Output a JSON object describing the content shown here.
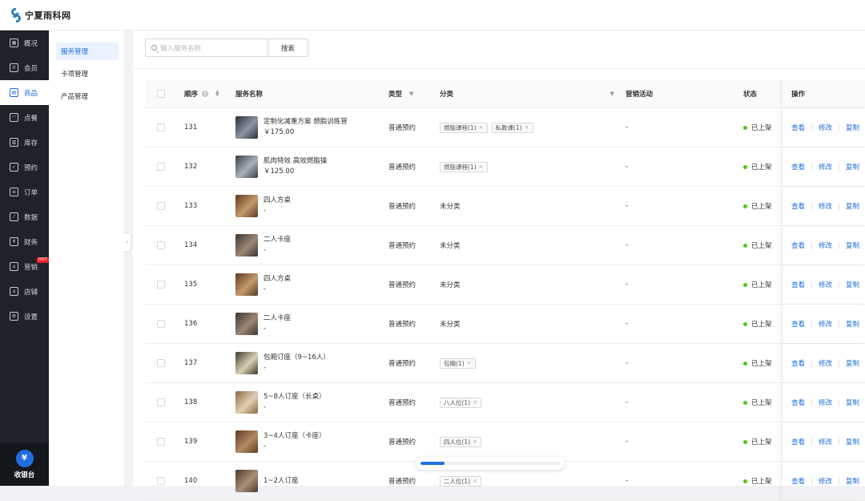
{
  "brand": {
    "name": "宁夏雨科网"
  },
  "main_nav": [
    {
      "label": "概况",
      "icon": "overview-icon",
      "glyph": "▦"
    },
    {
      "label": "会员",
      "icon": "crown-icon",
      "glyph": "♔"
    },
    {
      "label": "商品",
      "icon": "store-icon",
      "glyph": "▤",
      "active": true
    },
    {
      "label": "点餐",
      "icon": "dish-icon",
      "glyph": "◠"
    },
    {
      "label": "库存",
      "icon": "inventory-icon",
      "glyph": "▥"
    },
    {
      "label": "预约",
      "icon": "calendar-check-icon",
      "glyph": "✓"
    },
    {
      "label": "订单",
      "icon": "order-icon",
      "glyph": "≡"
    },
    {
      "label": "数据",
      "icon": "chart-icon",
      "glyph": "⟋"
    },
    {
      "label": "财务",
      "icon": "finance-icon",
      "glyph": "¥"
    },
    {
      "label": "营销",
      "icon": "marketing-icon",
      "glyph": "⌂",
      "badge": "HOT"
    },
    {
      "label": "店铺",
      "icon": "shop-icon",
      "glyph": "⌂"
    },
    {
      "label": "设置",
      "icon": "settings-icon",
      "glyph": "⚙"
    }
  ],
  "cashier": {
    "label": "收银台",
    "glyph": "¥"
  },
  "sub_nav": [
    {
      "label": "服务管理",
      "active": true
    },
    {
      "label": "卡项管理"
    },
    {
      "label": "产品管理"
    }
  ],
  "search": {
    "placeholder": "输入服务名称",
    "button": "搜索"
  },
  "table": {
    "headers": {
      "seq": "顺序",
      "name": "服务名称",
      "type": "类型",
      "category": "分类",
      "marketing": "营销活动",
      "status": "状态",
      "actions": "操作"
    },
    "rows": [
      {
        "seq": "131",
        "name": "定制化减重方案 燃脂训练营",
        "sub": "￥175.00",
        "type": "普通预约",
        "tags": [
          "燃脂课程(1)",
          "私教课(1)"
        ],
        "category_text": "",
        "marketing": "-",
        "status": "已上架",
        "thumb": [
          "#2b2f36",
          "#8b95a3"
        ]
      },
      {
        "seq": "132",
        "name": "肌肉特效 高效燃脂操",
        "sub": "￥125.00",
        "type": "普通预约",
        "tags": [
          "燃脂课程(1)"
        ],
        "category_text": "",
        "marketing": "-",
        "status": "已上架",
        "thumb": [
          "#3a3f47",
          "#a9b0ba"
        ]
      },
      {
        "seq": "133",
        "name": "四人方桌",
        "sub": "-",
        "type": "普通预约",
        "tags": [],
        "category_text": "未分类",
        "marketing": "-",
        "status": "已上架",
        "thumb": [
          "#5a3a22",
          "#c49a6c"
        ]
      },
      {
        "seq": "134",
        "name": "二人卡座",
        "sub": "-",
        "type": "普通预约",
        "tags": [],
        "category_text": "未分类",
        "marketing": "-",
        "status": "已上架",
        "thumb": [
          "#3b3430",
          "#9c8776"
        ]
      },
      {
        "seq": "135",
        "name": "四人方桌",
        "sub": "-",
        "type": "普通预约",
        "tags": [],
        "category_text": "未分类",
        "marketing": "-",
        "status": "已上架",
        "thumb": [
          "#5a3a22",
          "#c49a6c"
        ]
      },
      {
        "seq": "136",
        "name": "二人卡座",
        "sub": "-",
        "type": "普通预约",
        "tags": [],
        "category_text": "未分类",
        "marketing": "-",
        "status": "已上架",
        "thumb": [
          "#3b3430",
          "#9c8776"
        ]
      },
      {
        "seq": "137",
        "name": "包厢订座（9~16人）",
        "sub": "-",
        "type": "普通预约",
        "tags": [
          "包厢(1)"
        ],
        "category_text": "",
        "marketing": "-",
        "status": "已上架",
        "thumb": [
          "#3d3a2c",
          "#d8cfb4"
        ]
      },
      {
        "seq": "138",
        "name": "5~8人订座（长桌）",
        "sub": "-",
        "type": "普通预约",
        "tags": [
          "八人位(1)"
        ],
        "category_text": "",
        "marketing": "-",
        "status": "已上架",
        "thumb": [
          "#8a6a45",
          "#e0cfb2"
        ]
      },
      {
        "seq": "139",
        "name": "3~4人订座（卡座）",
        "sub": "-",
        "type": "普通预约",
        "tags": [
          "四人位(1)"
        ],
        "category_text": "",
        "marketing": "-",
        "status": "已上架",
        "thumb": [
          "#5c3b24",
          "#b58a62"
        ]
      },
      {
        "seq": "140",
        "name": "1~2人订座",
        "sub": "",
        "type": "普通预约",
        "tags": [
          "二人位(1)"
        ],
        "category_text": "",
        "marketing": "-",
        "status": "已上架",
        "thumb": [
          "#4a3a2e",
          "#a98f77"
        ]
      }
    ],
    "actions": [
      "查看",
      "修改",
      "复制"
    ]
  },
  "progress": {
    "fraction": 0.17
  },
  "colors": {
    "accent": "#1f6fe0",
    "online": "#52c41a",
    "nav_bg": "#1f2329"
  }
}
